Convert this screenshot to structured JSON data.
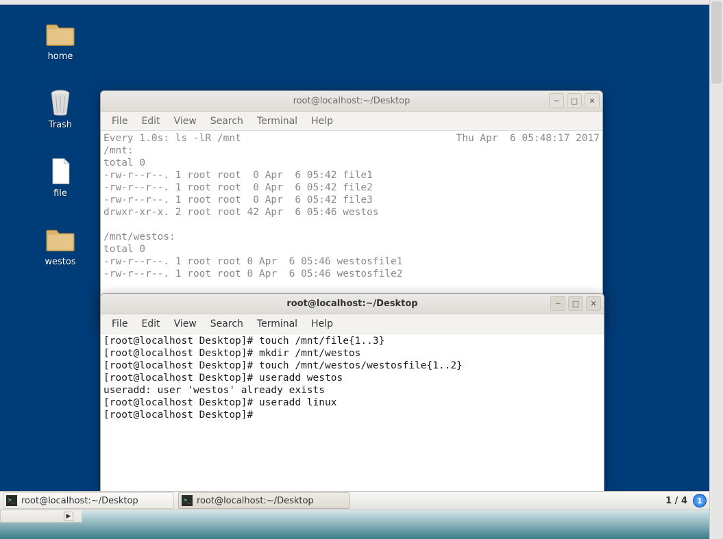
{
  "desktop_icons": {
    "home": "home",
    "trash": "Trash",
    "file": "file",
    "westos": "westos"
  },
  "window_back": {
    "title": "root@localhost:~/Desktop",
    "menu": {
      "file": "File",
      "edit": "Edit",
      "view": "View",
      "search": "Search",
      "terminal": "Terminal",
      "help": "Help"
    },
    "header_left": "Every 1.0s: ls -lR /mnt",
    "header_right": "Thu Apr  6 05:48:17 2017",
    "lines": [
      "/mnt:",
      "total 0",
      "-rw-r--r--. 1 root root  0 Apr  6 05:42 file1",
      "-rw-r--r--. 1 root root  0 Apr  6 05:42 file2",
      "-rw-r--r--. 1 root root  0 Apr  6 05:42 file3",
      "drwxr-xr-x. 2 root root 42 Apr  6 05:46 westos",
      "",
      "/mnt/westos:",
      "total 0",
      "-rw-r--r--. 1 root root 0 Apr  6 05:46 westosfile1",
      "-rw-r--r--. 1 root root 0 Apr  6 05:46 westosfile2"
    ]
  },
  "window_front": {
    "title": "root@localhost:~/Desktop",
    "menu": {
      "file": "File",
      "edit": "Edit",
      "view": "View",
      "search": "Search",
      "terminal": "Terminal",
      "help": "Help"
    },
    "lines": [
      "[root@localhost Desktop]# touch /mnt/file{1..3}",
      "[root@localhost Desktop]# mkdir /mnt/westos",
      "[root@localhost Desktop]# touch /mnt/westos/westosfile{1..2}",
      "[root@localhost Desktop]# useradd westos",
      "useradd: user 'westos' already exists",
      "[root@localhost Desktop]# useradd linux",
      "[root@localhost Desktop]# "
    ]
  },
  "taskbar": {
    "item1": "root@localhost:~/Desktop",
    "item2": "root@localhost:~/Desktop",
    "pager": "1 / 4",
    "badge": "1"
  }
}
